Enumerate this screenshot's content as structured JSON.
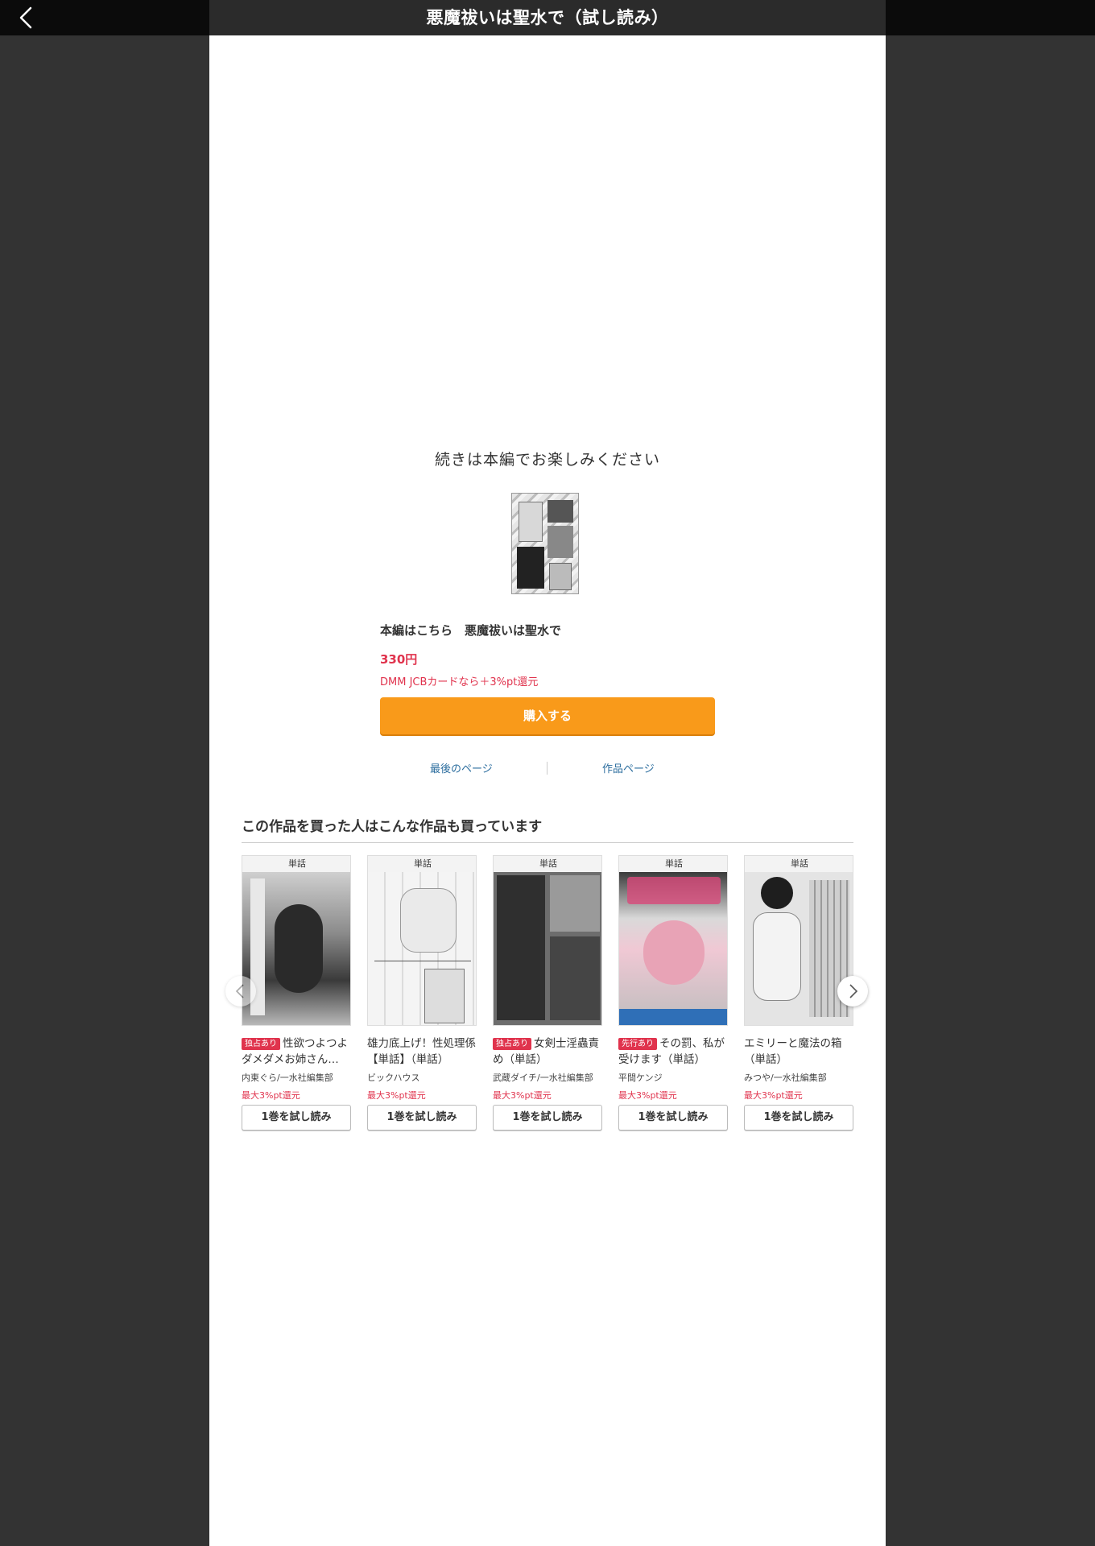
{
  "header": {
    "title": "悪魔祓いは聖水で（試し読み）",
    "back_icon": "chevron-left-icon"
  },
  "end_section": {
    "continue_text": "続きは本編でお楽しみください",
    "product_title": "本編はこちら　悪魔祓いは聖水で",
    "price": "330円",
    "campaign": "DMM JCBカードなら＋3%pt還元",
    "buy_label": "購入する",
    "last_page_link": "最後のページ",
    "work_page_link": "作品ページ"
  },
  "recommendations": {
    "heading": "この作品を買った人はこんな作品も買っています",
    "items": [
      {
        "label": "単話",
        "badge": "独占あり",
        "title": "性欲つよつよダメダメお姉さん…",
        "author": "内東ぐら/一水社編集部",
        "points": "最大3%pt還元",
        "button": "1巻を試し読み"
      },
      {
        "label": "単話",
        "badge": "",
        "title": "雄力底上げ！性処理係【単話】（単話）",
        "author": "ビックハウス",
        "points": "最大3%pt還元",
        "button": "1巻を試し読み"
      },
      {
        "label": "単話",
        "badge": "独占あり",
        "title": "女剣士淫蟲責め（単話）",
        "author": "武蔵ダイチ/一水社編集部",
        "points": "最大3%pt還元",
        "button": "1巻を試し読み"
      },
      {
        "label": "単話",
        "badge": "先行あり",
        "title": "その罰、私が受けます（単話）",
        "author": "平間ケンジ",
        "points": "最大3%pt還元",
        "button": "1巻を試し読み"
      },
      {
        "label": "単話",
        "badge": "",
        "title": "エミリーと魔法の箱（単話）",
        "author": "みつや/一水社編集部",
        "points": "最大3%pt還元",
        "button": "1巻を試し読み"
      }
    ]
  },
  "colors": {
    "accent_orange": "#f99a1a",
    "price_red": "#e0334d",
    "link_blue": "#2b6d9e"
  }
}
